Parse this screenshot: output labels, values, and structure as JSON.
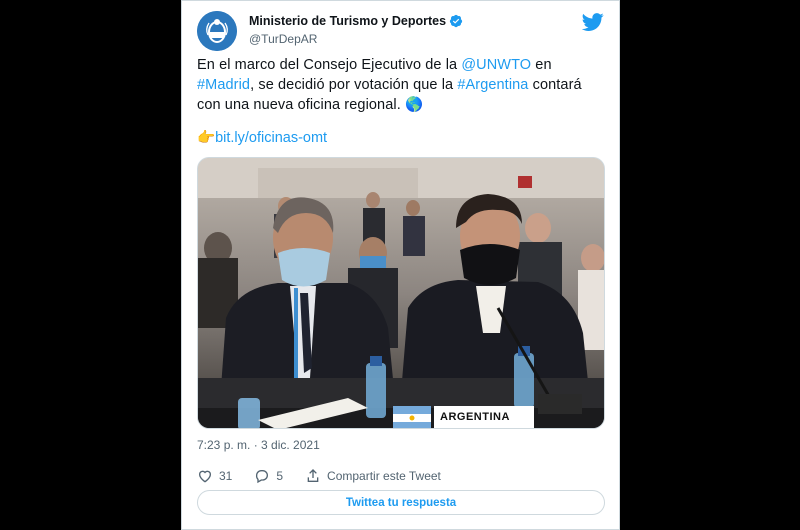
{
  "account": {
    "name": "Ministerio de Turismo y Deportes",
    "handle": "@TurDepAR"
  },
  "tweet": {
    "text_part1": "En el marco del Consejo Ejecutivo de la ",
    "mention": "@UNWTO",
    "text_part2": " en ",
    "hashtag1": "#Madrid",
    "text_part3": ", se decidió por votación que la ",
    "hashtag2": "#Argentina",
    "text_part4": " contará con una nueva oficina regional. ",
    "globe_emoji": "🌎",
    "pointer_emoji": "👉",
    "link": "bit.ly/oficinas-omt",
    "timestamp": "7:23 p. m. · 3 dic. 2021"
  },
  "photo": {
    "placard_text": "ARGENTINA"
  },
  "actions": {
    "likes": "31",
    "replies": "5",
    "share_label": "Compartir este Tweet"
  },
  "reply_button_label": "Twittea tu respuesta",
  "colors": {
    "accent": "#1d9bf0",
    "text": "#0f1419",
    "secondary": "#536471",
    "border": "#cfd9de"
  },
  "icons": [
    "avatar-logo",
    "verified-badge-icon",
    "twitter-bird-icon",
    "pointing-hand-icon",
    "globe-icon",
    "heart-icon",
    "reply-icon",
    "share-icon"
  ]
}
